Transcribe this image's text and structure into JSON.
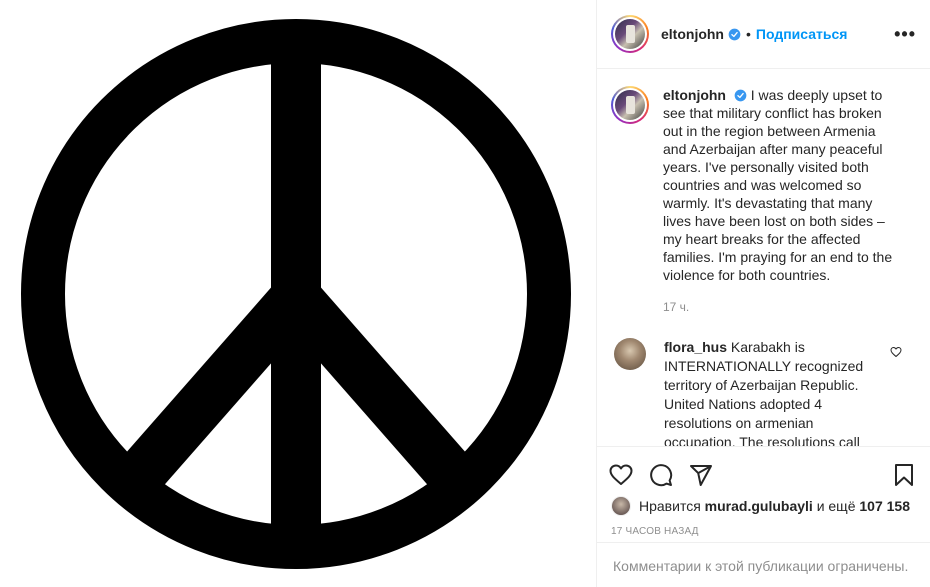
{
  "header": {
    "username": "eltonjohn",
    "separator": "•",
    "follow_label": "Подписаться",
    "more_label": "•••"
  },
  "caption": {
    "username": "eltonjohn",
    "text": "I was deeply upset to see that military conflict has broken out in the region between Armenia and Azerbaijan after many peaceful years. I've personally visited both countries and was welcomed so warmly. It's devastating that many lives have been lost on both sides – my heart breaks for the affected families. I'm praying for an end to the violence for both countries.",
    "time": "17 ч."
  },
  "comments": [
    {
      "username": "flora_hus",
      "text": "Karabakh is INTERNATIONALLY recognized territory of Azerbaijan Republic. United Nations adopted 4 resolutions on armenian occupation. The resolutions call"
    }
  ],
  "likes": {
    "prefix": "Нравится",
    "user": "murad.gulubayli",
    "and_more": "и ещё",
    "count": "107 158"
  },
  "time_ago": "17 ЧАСОВ НАЗАД",
  "comments_closed": "Комментарии к этой публикации ограничены.",
  "icons": {
    "like": "heart-icon",
    "comment": "comment-icon",
    "share": "share-icon",
    "save": "bookmark-icon",
    "verified": "verified-badge-icon",
    "options": "more-options-icon"
  },
  "colors": {
    "follow": "#0095f6",
    "verified": "#3897f0",
    "muted": "#8e8e8e",
    "text": "#262626"
  }
}
